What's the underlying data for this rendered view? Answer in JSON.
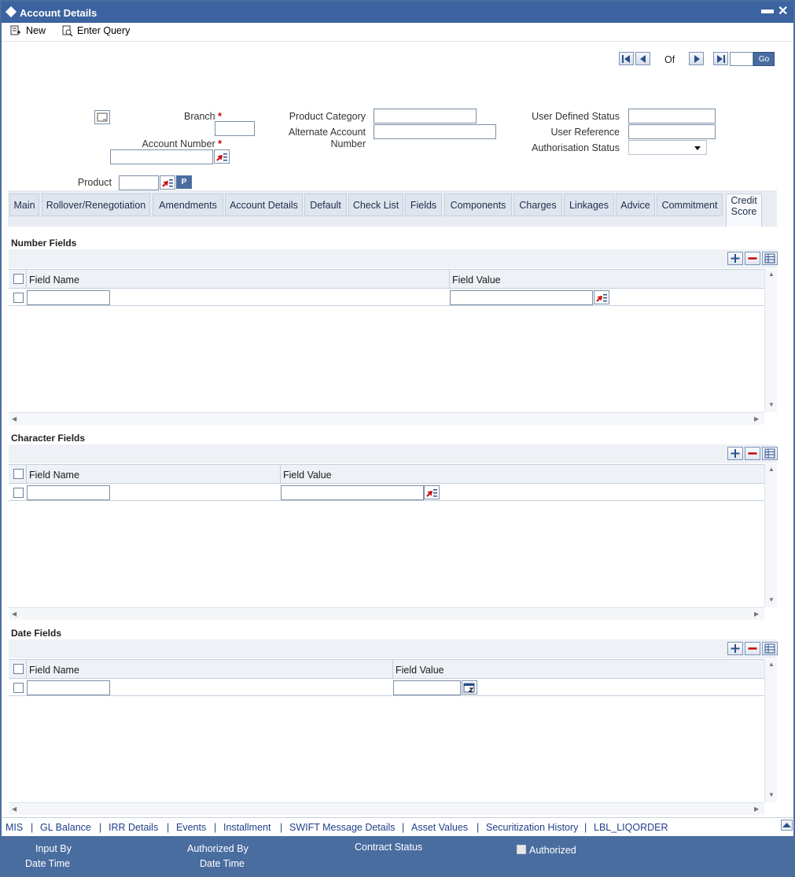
{
  "window": {
    "title": "Account Details",
    "minimize": "▬",
    "close": "✕"
  },
  "toolbar": {
    "new_label": "New",
    "query_label": "Enter Query"
  },
  "nav": {
    "of_label": "Of",
    "go_label": "Go"
  },
  "header": {
    "branch_label": "Branch",
    "account_number_label": "Account Number",
    "product_label": "Product",
    "product_btn": "P",
    "product_category_label": "Product Category",
    "alt_account_label_1": "Alternate Account",
    "alt_account_label_2": "Number",
    "user_status_label": "User Defined Status",
    "user_reference_label": "User Reference",
    "auth_status_label": "Authorisation Status",
    "required_mark": "*"
  },
  "tabs": [
    {
      "label": "Main"
    },
    {
      "label": "Rollover/Renegotiation"
    },
    {
      "label": "Amendments"
    },
    {
      "label": "Account Details"
    },
    {
      "label": "Default"
    },
    {
      "label": "Check List"
    },
    {
      "label": "Fields"
    },
    {
      "label": "Components"
    },
    {
      "label": "Charges"
    },
    {
      "label": "Linkages"
    },
    {
      "label": "Advice"
    },
    {
      "label": "Commitment"
    },
    {
      "label_1": "Credit",
      "label_2": "Score",
      "active": true
    }
  ],
  "sections": {
    "number": {
      "title": "Number Fields",
      "col_name": "Field Name",
      "col_value": "Field Value"
    },
    "character": {
      "title": "Character Fields",
      "col_name": "Field Name",
      "col_value": "Field Value"
    },
    "date": {
      "title": "Date Fields",
      "col_name": "Field Name",
      "col_value": "Field Value"
    }
  },
  "links": [
    "MIS",
    "GL Balance",
    "IRR Details",
    "Events",
    "Installment",
    "SWIFT Message Details",
    "Asset Values",
    "Securitization History",
    "LBL_LIQORDER"
  ],
  "link_separator": "|",
  "footer": {
    "input_by": "Input By",
    "date_time_1": "Date Time",
    "authorized_by": "Authorized By",
    "date_time_2": "Date Time",
    "contract_status": "Contract Status",
    "authorized": "Authorized"
  },
  "colors": {
    "brand": "#3b63a0",
    "footer": "#4a6da0",
    "link": "#1f3f8a",
    "required": "#cc0000"
  }
}
